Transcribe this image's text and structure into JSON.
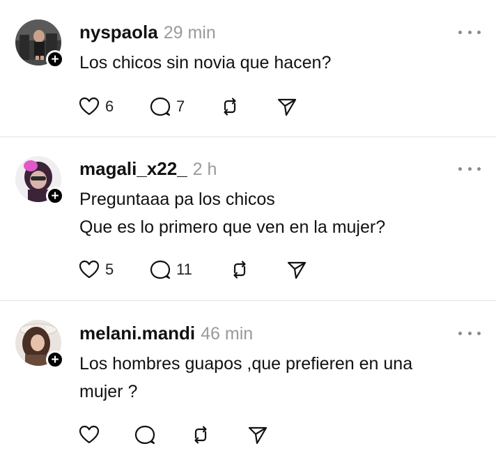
{
  "posts": [
    {
      "username": "nyspaola",
      "time": "29 min",
      "text": "Los chicos sin novia que hacen?",
      "likes": "6",
      "replies": "7"
    },
    {
      "username": "magali_x22_",
      "time": "2 h",
      "text": "Preguntaaa pa los chicos\nQue es lo primero que ven en la mujer?",
      "likes": "5",
      "replies": "11"
    },
    {
      "username": "melani.mandi",
      "time": "46 min",
      "text": "Los hombres guapos ,que prefieren en una\nmujer ?",
      "likes": "",
      "replies": ""
    }
  ],
  "icons": {
    "like": "heart-icon",
    "reply": "comment-bubble-icon",
    "repost": "repost-icon",
    "share": "send-icon",
    "more": "more-options-icon",
    "follow": "plus-icon"
  }
}
